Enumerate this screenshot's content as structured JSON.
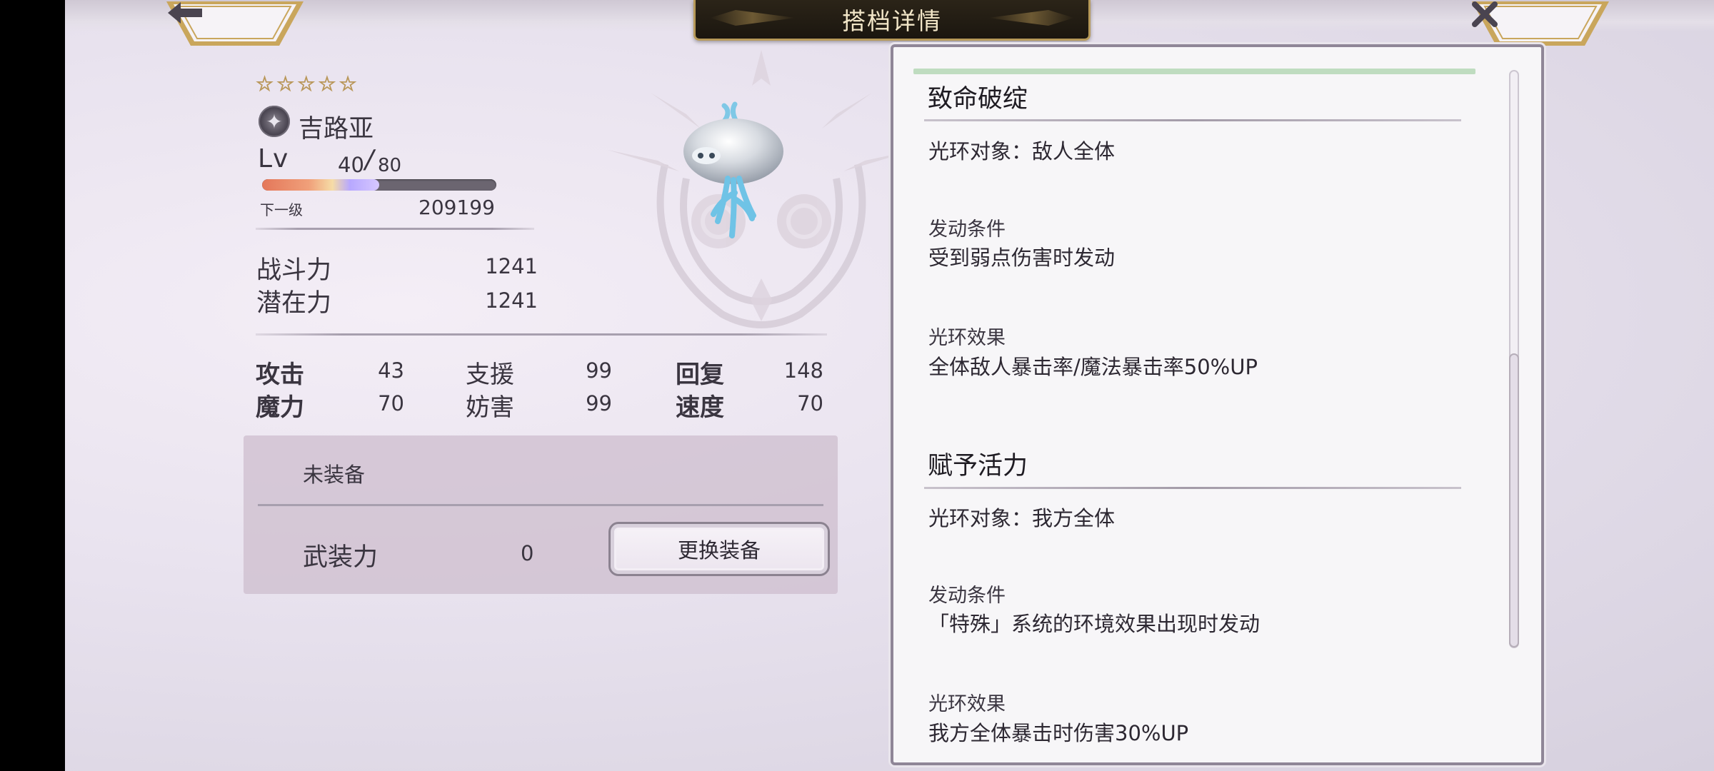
{
  "header": {
    "title": "搭档详情",
    "back_icon": "arrow-left-icon",
    "close_icon": "close-x-icon"
  },
  "character": {
    "stars": [
      "☆",
      "☆",
      "☆",
      "☆",
      "☆"
    ],
    "star_count": 5,
    "element_icon": "sparkle-element-icon",
    "name": "吉路亚",
    "lv_label": "Lv",
    "level": "40",
    "level_separator": "/",
    "max_level": "80",
    "exp_progress_fraction": 0.5,
    "next_label": "下一级",
    "next_value": "209199",
    "power_label": "战斗力",
    "power_value": "1241",
    "potential_label": "潜在力",
    "potential_value": "1241"
  },
  "stats": {
    "attack": {
      "label": "攻击",
      "value": "43"
    },
    "support": {
      "label": "支援",
      "value": "99"
    },
    "recovery": {
      "label": "回复",
      "value": "148"
    },
    "magic": {
      "label": "魔力",
      "value": "70"
    },
    "hinder": {
      "label": "妨害",
      "value": "99"
    },
    "speed": {
      "label": "速度",
      "value": "70"
    }
  },
  "equipment": {
    "status": "未装备",
    "armament_label": "武装力",
    "armament_value": "0",
    "change_button": "更换装备"
  },
  "skills": [
    {
      "title": "致命破绽",
      "target": "光环对象：敌人全体",
      "condition_label": "发动条件",
      "condition": "受到弱点伤害时发动",
      "effect_label": "光环效果",
      "effect": "全体敌人暴击率/魔法暴击率50%UP"
    },
    {
      "title": "赋予活力",
      "target": "光环对象：我方全体",
      "condition_label": "发动条件",
      "condition": "「特殊」系统的环境效果出现时发动",
      "effect_label": "光环效果",
      "effect": "我方全体暴击时伤害30%UP"
    }
  ],
  "colors": {
    "title_bg": "#1b160f",
    "title_text": "#f2e6c8",
    "gold_border": "#b79a5a",
    "panel_bg": "#f7f6f8",
    "equip_bg": "#cdbecd"
  }
}
